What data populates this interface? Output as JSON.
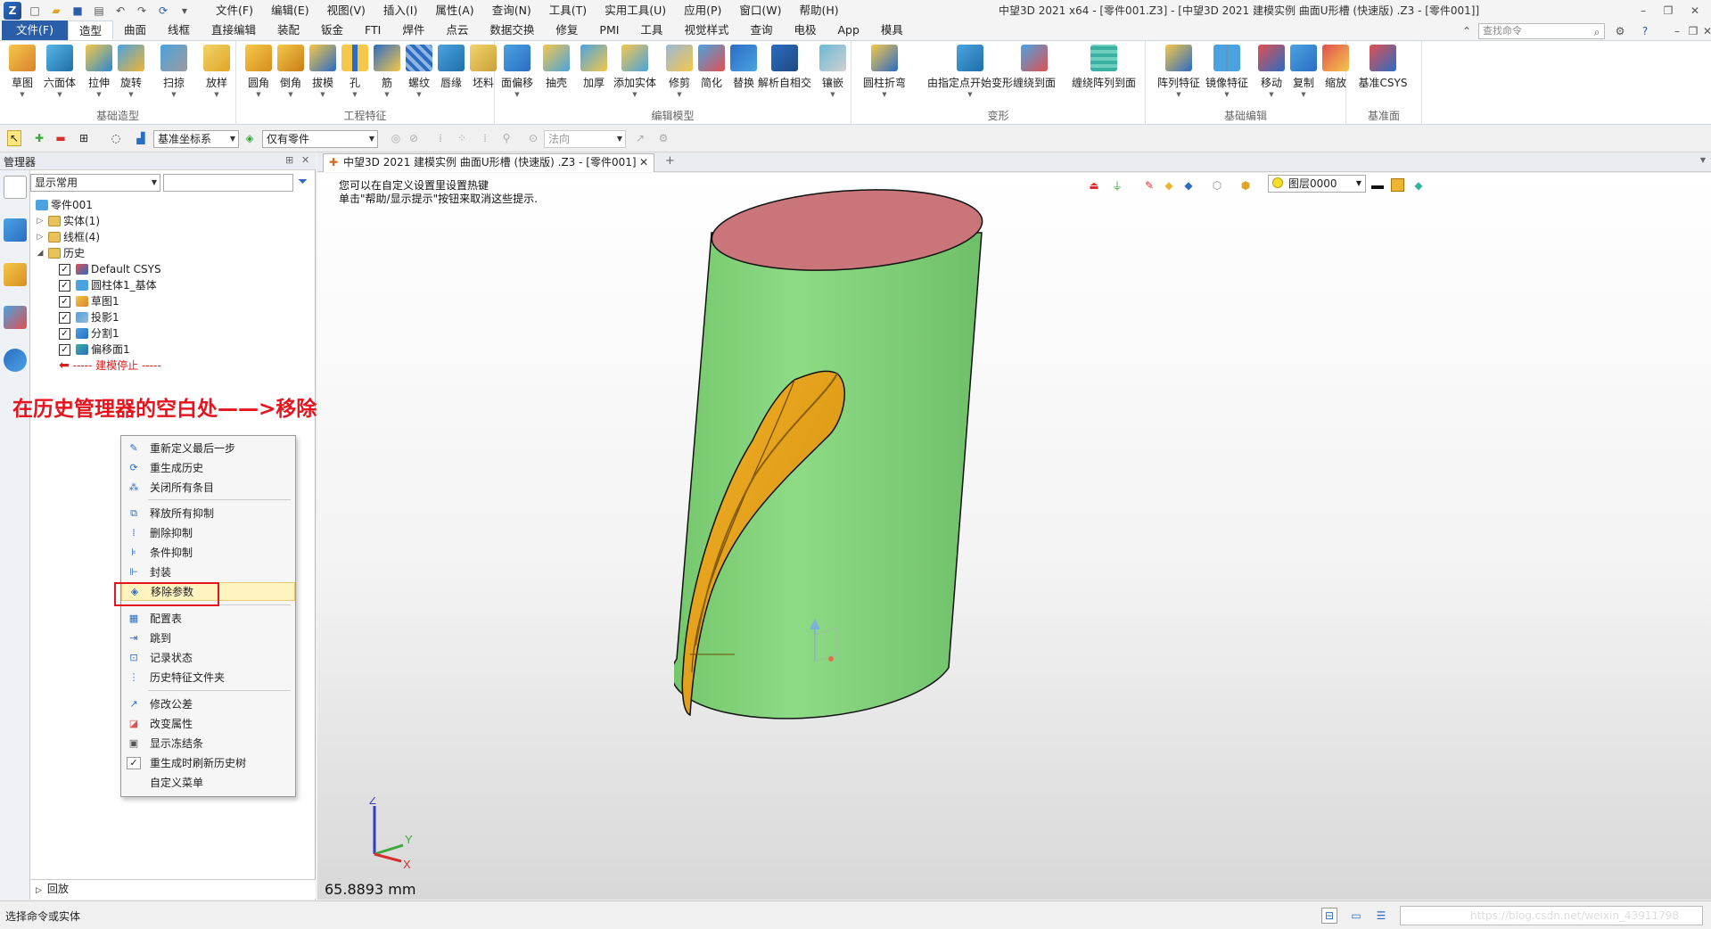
{
  "titlebar": {
    "menus": [
      "文件(F)",
      "编辑(E)",
      "视图(V)",
      "插入(I)",
      "属性(A)",
      "查询(N)",
      "工具(T)",
      "实用工具(U)",
      "应用(P)",
      "窗口(W)",
      "帮助(H)"
    ],
    "window_title": "中望3D 2021 x64 - [零件001.Z3] - [中望3D 2021 建模实例 曲面U形槽 (快速版) .Z3 - [零件001]]"
  },
  "ribbon_tabs": [
    "文件(F)",
    "造型",
    "曲面",
    "线框",
    "直接编辑",
    "装配",
    "钣金",
    "FTI",
    "焊件",
    "点云",
    "数据交换",
    "修复",
    "PMI",
    "工具",
    "视觉样式",
    "查询",
    "电极",
    "App",
    "模具"
  ],
  "search": {
    "placeholder": "查找命令"
  },
  "ribbon_groups": [
    {
      "label": "基础造型",
      "buttons": [
        "草图",
        "六面体",
        "拉伸",
        "旋转",
        "扫掠",
        "放样"
      ]
    },
    {
      "label": "工程特征",
      "buttons": [
        "圆角",
        "倒角",
        "拔模",
        "孔",
        "筋",
        "螺纹",
        "唇缘",
        "坯料"
      ]
    },
    {
      "label": "编辑模型",
      "buttons": [
        "面偏移",
        "抽壳",
        "加厚",
        "添加实体",
        "修剪",
        "简化",
        "替换",
        "解析自相交",
        "镶嵌"
      ]
    },
    {
      "label": "变形",
      "buttons": [
        "圆柱折弯",
        "由指定点开始变形",
        "缠绕到面",
        "缠绕阵列到面"
      ]
    },
    {
      "label": "基础编辑",
      "buttons": [
        "阵列特征",
        "镜像特征",
        "移动",
        "复制",
        "缩放"
      ]
    },
    {
      "label": "基准面",
      "buttons": [
        "基准CSYS"
      ]
    }
  ],
  "toolbar2": {
    "csys_combo": "基准坐标系",
    "filter_combo": "仅有零件",
    "direction_combo": "法向"
  },
  "manager": {
    "title": "管理器",
    "display_combo": "显示常用",
    "root": "零件001",
    "nodes": {
      "solid": "实体(1)",
      "wireframe": "线框(4)",
      "history": "历史"
    },
    "history_items": [
      "Default CSYS",
      "圆柱体1_基体",
      "草图1",
      "投影1",
      "分割1",
      "偏移面1"
    ],
    "stop_label": "----- 建模停止 -----",
    "rollback": "回放"
  },
  "annotation": "在历史管理器的空白处——>移除参数",
  "context_menu": {
    "items": [
      "重新定义最后一步",
      "重生成历史",
      "关闭所有条目",
      "释放所有抑制",
      "删除抑制",
      "条件抑制",
      "封装",
      "移除参数",
      "配置表",
      "跳到",
      "记录状态",
      "历史特征文件夹",
      "修改公差",
      "改变属性",
      "显示冻结条",
      "重生成时刷新历史树",
      "自定义菜单"
    ],
    "highlighted": "移除参数",
    "checked": "重生成时刷新历史树"
  },
  "doc_tab": {
    "label": "中望3D 2021 建模实例 曲面U形槽 (快速版) .Z3 - [零件001]"
  },
  "viewport": {
    "hint_line1": "您可以在自定义设置里设置热键",
    "hint_line2": "单击\"帮助/显示提示\"按钮来取消这些提示.",
    "layer": "图层0000",
    "measure": "65.8893 mm",
    "axes": {
      "x": "X",
      "y": "Y",
      "z": "Z"
    },
    "colors": {
      "body": "#86d47f",
      "top_face": "#c97579",
      "groove": "#e8a818",
      "groove_dark": "#8a5f00"
    }
  },
  "status": {
    "text": "选择命令或实体",
    "watermark": "https://blog.csdn.net/weixin_43911798"
  }
}
